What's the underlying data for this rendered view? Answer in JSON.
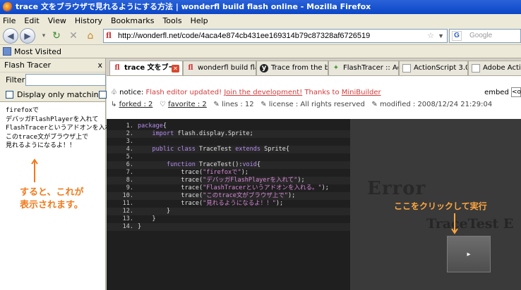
{
  "window": {
    "title": "trace 文をブラウザで見れるようにする方法 | wonderfl build flash online - Mozilla Firefox"
  },
  "menu": [
    "File",
    "Edit",
    "View",
    "History",
    "Bookmarks",
    "Tools",
    "Help"
  ],
  "nav": {
    "url": "http://wonderfl.net/code/4aca4e874cb431ee169314b79c87328af6726519",
    "search_placeholder": "Google",
    "bookmarks_label": "Most Visited"
  },
  "sidebar": {
    "title": "Flash Tracer",
    "close": "x",
    "filter_label": "Filter",
    "filter_value": "",
    "matching_label": "Display only matching rules",
    "trace_lines": [
      "firefoxで",
      "デバッガFlashPlayerを入れて",
      "FlashTracerというアドオンを入れる。",
      "このtrace文がブラウザ上で",
      "見れるようになるよ！！"
    ],
    "annotation": [
      "すると、これが",
      "表示されます。"
    ]
  },
  "tabs": [
    {
      "label": "trace 文をブー",
      "icon": "wonderfl-icon",
      "active": true
    },
    {
      "label": "wonderfl build fla…",
      "icon": "wonderfl-icon",
      "active": false
    },
    {
      "label": "Trace from the br…",
      "icon": "yahoo-icon",
      "active": false
    },
    {
      "label": "FlashTracer :: Ad…",
      "icon": "addon-icon",
      "active": false
    },
    {
      "label": "ActionScript 3.0 …",
      "icon": "document-icon",
      "active": false
    },
    {
      "label": "Adobe ActionS…",
      "icon": "document-icon",
      "active": false
    }
  ],
  "page": {
    "notice_prefix": "notice:",
    "notice_text": "Flash editor updated!",
    "notice_link1": "Join the development!",
    "notice_middle": "Thanks to",
    "notice_link2": "MiniBuilder",
    "embed_label": "embed",
    "embed_value": "<o",
    "forked": "forked : 2",
    "favorite": "favorite : 2",
    "lines": "lines : 12",
    "license": "license : All rights reserved",
    "modified": "modified : 2008/12/24 21:29:04"
  },
  "code": [
    {
      "n": "1.",
      "t": [
        [
          "kw",
          "package"
        ],
        [
          "fn",
          "{"
        ]
      ]
    },
    {
      "n": "2.",
      "t": [
        [
          "fn",
          "    "
        ],
        [
          "kw",
          "import"
        ],
        [
          "fn",
          " flash.display.Sprite;"
        ]
      ]
    },
    {
      "n": "3.",
      "t": []
    },
    {
      "n": "4.",
      "t": [
        [
          "fn",
          "    "
        ],
        [
          "kw",
          "public class"
        ],
        [
          "fn",
          " TraceTest "
        ],
        [
          "kw",
          "extends"
        ],
        [
          "fn",
          " Sprite{"
        ]
      ]
    },
    {
      "n": "5.",
      "t": []
    },
    {
      "n": "6.",
      "t": [
        [
          "fn",
          "        "
        ],
        [
          "kw",
          "function"
        ],
        [
          "fn",
          " TraceTest():"
        ],
        [
          "kw",
          "void"
        ],
        [
          "fn",
          "{"
        ]
      ]
    },
    {
      "n": "7.",
      "t": [
        [
          "fn",
          "            trace("
        ],
        [
          "str",
          "\"firefoxで\""
        ],
        [
          "fn",
          ");"
        ]
      ]
    },
    {
      "n": "8.",
      "t": [
        [
          "fn",
          "            trace("
        ],
        [
          "str",
          "\"デバッガFlashPlayerを入れて\""
        ],
        [
          "fn",
          ");"
        ]
      ]
    },
    {
      "n": "9.",
      "t": [
        [
          "fn",
          "            trace("
        ],
        [
          "str",
          "\"FlashTracerというアドオンを入れる。\""
        ],
        [
          "fn",
          ");"
        ]
      ]
    },
    {
      "n": "10.",
      "t": [
        [
          "fn",
          "            trace("
        ],
        [
          "str",
          "\"このtrace文がブラウザ上で\""
        ],
        [
          "fn",
          ");"
        ]
      ]
    },
    {
      "n": "11.",
      "t": [
        [
          "fn",
          "            trace("
        ],
        [
          "str",
          "\"見れるようになるよ！！\""
        ],
        [
          "fn",
          ");"
        ]
      ]
    },
    {
      "n": "12.",
      "t": [
        [
          "fn",
          "        }"
        ]
      ]
    },
    {
      "n": "13.",
      "t": [
        [
          "fn",
          "    }"
        ]
      ]
    },
    {
      "n": "14.",
      "t": [
        [
          "fn",
          "}"
        ]
      ]
    }
  ],
  "flash": {
    "error_text": "Error",
    "error_sub": "TraceTest E",
    "tip": "ここをクリックして実行",
    "play": "▸"
  },
  "colors": {
    "accent_orange": "#f07a1c",
    "editor_bg": "#1f1f1f",
    "keyword": "#b58cf0",
    "string": "#d98ad9"
  }
}
